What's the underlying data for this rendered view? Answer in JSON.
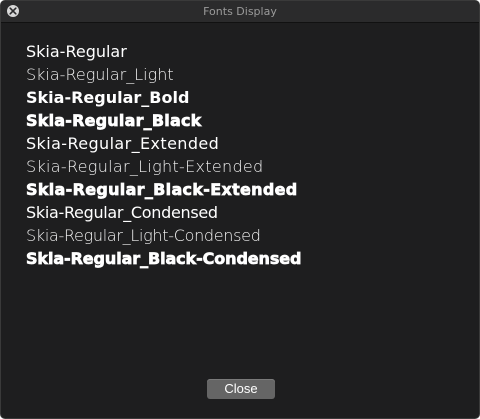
{
  "window": {
    "title": "Fonts Display"
  },
  "fonts": [
    {
      "label": "Skia-Regular"
    },
    {
      "label": "Skia-Regular_Light"
    },
    {
      "label": "Skia-Regular_Bold"
    },
    {
      "label": "Skia-Regular_Black"
    },
    {
      "label": "Skia-Regular_Extended"
    },
    {
      "label": "Skia-Regular_Light-Extended"
    },
    {
      "label": "Skia-Regular_Black-Extended"
    },
    {
      "label": "Skia-Regular_Condensed"
    },
    {
      "label": "Skia-Regular_Light-Condensed"
    },
    {
      "label": "Skia-Regular_Black-Condensed"
    }
  ],
  "footer": {
    "close_label": "Close"
  },
  "icons": {
    "window_close": "close-icon"
  },
  "colors": {
    "background": "#1e1e1f",
    "text": "#ffffff",
    "button": "#656565"
  }
}
